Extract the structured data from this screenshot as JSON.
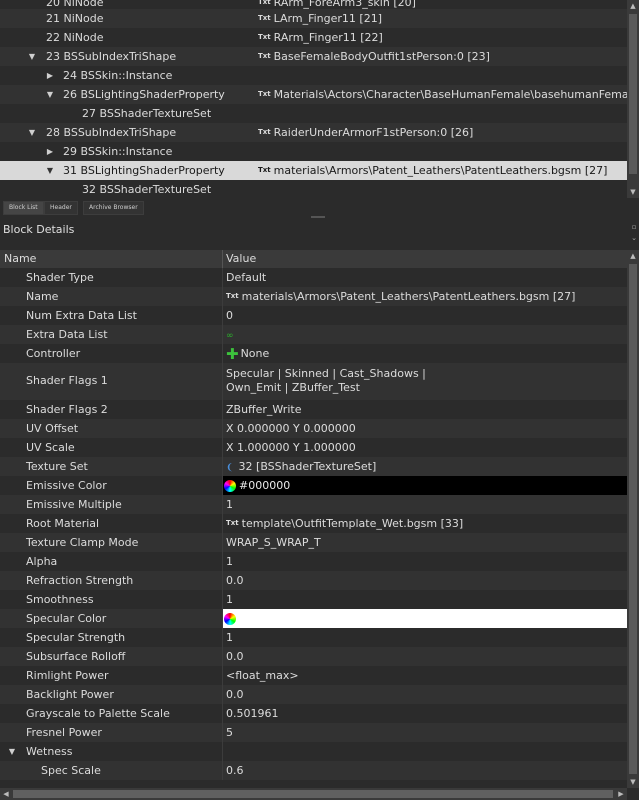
{
  "tree": {
    "rows": [
      {
        "name": "20 NiNode",
        "value": "RArm_ForeArm3_skin [20]",
        "arrow": "",
        "txt": true
      },
      {
        "name": "21 NiNode",
        "value": "LArm_Finger11 [21]",
        "arrow": "",
        "txt": true
      },
      {
        "name": "22 NiNode",
        "value": "RArm_Finger11 [22]",
        "arrow": "",
        "txt": true
      },
      {
        "name": "23 BSSubIndexTriShape",
        "value": "BaseFemaleBodyOutfit1stPerson:0 [23]",
        "arrow": "▼",
        "txt": true
      },
      {
        "name": "24 BSSkin::Instance",
        "value": "",
        "arrow": "▶",
        "txt": false
      },
      {
        "name": "26 BSLightingShaderProperty",
        "value": "Materials\\Actors\\Character\\BaseHumanFemale\\basehumanFemales...",
        "arrow": "▼",
        "txt": true
      },
      {
        "name": "27 BSShaderTextureSet",
        "value": "",
        "arrow": "",
        "txt": false
      },
      {
        "name": "28 BSSubIndexTriShape",
        "value": "RaiderUnderArmorF1stPerson:0 [26]",
        "arrow": "▼",
        "txt": true
      },
      {
        "name": "29 BSSkin::Instance",
        "value": "",
        "arrow": "▶",
        "txt": false
      },
      {
        "name": "31 BSLightingShaderProperty",
        "value": "materials\\Armors\\Patent_Leathers\\PatentLeathers.bgsm [27]",
        "arrow": "▼",
        "txt": true
      },
      {
        "name": "32 BSShaderTextureSet",
        "value": "",
        "arrow": "",
        "txt": false
      }
    ],
    "txt_label": "Txt"
  },
  "tabs": [
    "Block List",
    "Header",
    "Archive Browser"
  ],
  "block_details": {
    "title": "Block Details",
    "col_name": "Name",
    "col_value": "Value",
    "rows": [
      {
        "name": "Shader Type",
        "value": "Default"
      },
      {
        "name": "Name",
        "value": "materials\\Armors\\Patent_Leathers\\PatentLeathers.bgsm [27]"
      },
      {
        "name": "Num Extra Data List",
        "value": "0"
      },
      {
        "name": "Extra Data List",
        "value": ""
      },
      {
        "name": "Controller",
        "value": "None"
      },
      {
        "name": "Shader Flags 1",
        "value": "Specular | Skinned | Cast_Shadows |",
        "value2": "Own_Emit | ZBuffer_Test"
      },
      {
        "name": "Shader Flags 2",
        "value": "ZBuffer_Write"
      },
      {
        "name": "UV Offset",
        "value": "X 0.000000 Y 0.000000"
      },
      {
        "name": "UV Scale",
        "value": "X 1.000000 Y 1.000000"
      },
      {
        "name": "Texture Set",
        "value": "32 [BSShaderTextureSet]"
      },
      {
        "name": "Emissive Color",
        "value": "#000000"
      },
      {
        "name": "Emissive Multiple",
        "value": "1"
      },
      {
        "name": "Root Material",
        "value": "template\\OutfitTemplate_Wet.bgsm [33]"
      },
      {
        "name": "Texture Clamp Mode",
        "value": "WRAP_S_WRAP_T"
      },
      {
        "name": "Alpha",
        "value": "1"
      },
      {
        "name": "Refraction Strength",
        "value": "0.0"
      },
      {
        "name": "Smoothness",
        "value": "1"
      },
      {
        "name": "Specular Color",
        "value": ""
      },
      {
        "name": "Specular Strength",
        "value": "1"
      },
      {
        "name": "Subsurface Rolloff",
        "value": "0.0"
      },
      {
        "name": "Rimlight Power",
        "value": "<float_max>"
      },
      {
        "name": "Backlight Power",
        "value": "0.0"
      },
      {
        "name": "Grayscale to Palette Scale",
        "value": "0.501961"
      },
      {
        "name": "Fresnel Power",
        "value": "5"
      },
      {
        "name": "Wetness",
        "value": ""
      },
      {
        "name": "Spec Scale",
        "value": "0.6"
      }
    ]
  },
  "colors": {
    "emissive": "#000000",
    "specular": "#ffffff",
    "selection": "#d9d9d9"
  }
}
